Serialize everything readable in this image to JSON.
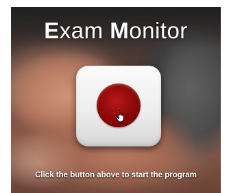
{
  "app": {
    "title_first_initial": "E",
    "title_first_rest": "xam ",
    "title_second_initial": "M",
    "title_second_rest": "onitor"
  },
  "start_button": {
    "icon": "record-icon",
    "color": "#8a0606"
  },
  "cursor": {
    "icon": "hand-pointer-icon"
  },
  "instructions": "Click the button above to start the program"
}
